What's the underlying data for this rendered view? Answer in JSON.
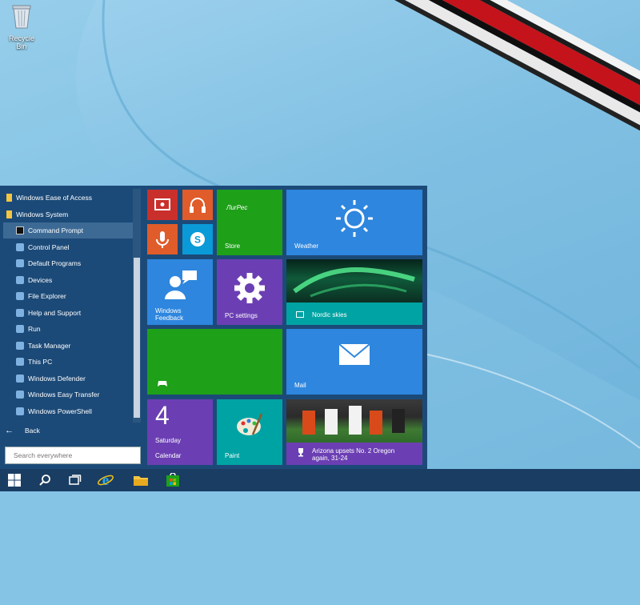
{
  "desktop": {
    "recycle_bin_label": "Recycle Bin"
  },
  "start_menu": {
    "apps": [
      {
        "label": "Windows Ease of Access",
        "icon": "folder-icon",
        "indent": false,
        "selected": false
      },
      {
        "label": "Windows System",
        "icon": "folder-icon",
        "indent": false,
        "selected": false
      },
      {
        "label": "Command Prompt",
        "icon": "command-prompt-icon",
        "indent": true,
        "selected": true
      },
      {
        "label": "Control Panel",
        "icon": "control-panel-icon",
        "indent": true,
        "selected": false
      },
      {
        "label": "Default Programs",
        "icon": "default-programs-icon",
        "indent": true,
        "selected": false
      },
      {
        "label": "Devices",
        "icon": "devices-icon",
        "indent": true,
        "selected": false
      },
      {
        "label": "File Explorer",
        "icon": "file-explorer-icon",
        "indent": true,
        "selected": false
      },
      {
        "label": "Help and Support",
        "icon": "help-icon",
        "indent": true,
        "selected": false
      },
      {
        "label": "Run",
        "icon": "run-icon",
        "indent": true,
        "selected": false
      },
      {
        "label": "Task Manager",
        "icon": "task-manager-icon",
        "indent": true,
        "selected": false
      },
      {
        "label": "This PC",
        "icon": "this-pc-icon",
        "indent": true,
        "selected": false
      },
      {
        "label": "Windows Defender",
        "icon": "defender-icon",
        "indent": true,
        "selected": false
      },
      {
        "label": "Windows Easy Transfer",
        "icon": "easy-transfer-icon",
        "indent": true,
        "selected": false
      },
      {
        "label": "Windows PowerShell",
        "icon": "powershell-icon",
        "indent": true,
        "selected": false
      }
    ],
    "back_label": "Back",
    "search_placeholder": "Search everywhere",
    "tiles": {
      "store": {
        "label": "Store",
        "text": "ЛurPec"
      },
      "weather": {
        "label": "Weather"
      },
      "feedback": {
        "label": "Windows Feedback"
      },
      "pc_settings": {
        "label": "PC settings"
      },
      "nordic": {
        "label": "Nordic skies"
      },
      "xbox": {
        "label": ""
      },
      "mail": {
        "label": "Mail"
      },
      "calendar": {
        "label": "Calendar",
        "day_number": "4",
        "day_name": "Saturday"
      },
      "paint": {
        "label": "Paint"
      },
      "sports": {
        "label": "Arizona upsets No. 2 Oregon again, 31-24"
      }
    }
  },
  "taskbar": {
    "items": [
      "start-button",
      "search-icon",
      "task-view-icon",
      "internet-explorer-icon",
      "file-explorer-icon",
      "store-icon"
    ]
  },
  "colors": {
    "menu_bg": "#1c4a78",
    "tile_red": "#c9302c",
    "tile_orange": "#e05c2a",
    "tile_green": "#1ea019",
    "tile_blue": "#2e86de",
    "tile_purple": "#6b3fb3",
    "tile_teal": "#00a3a3"
  }
}
